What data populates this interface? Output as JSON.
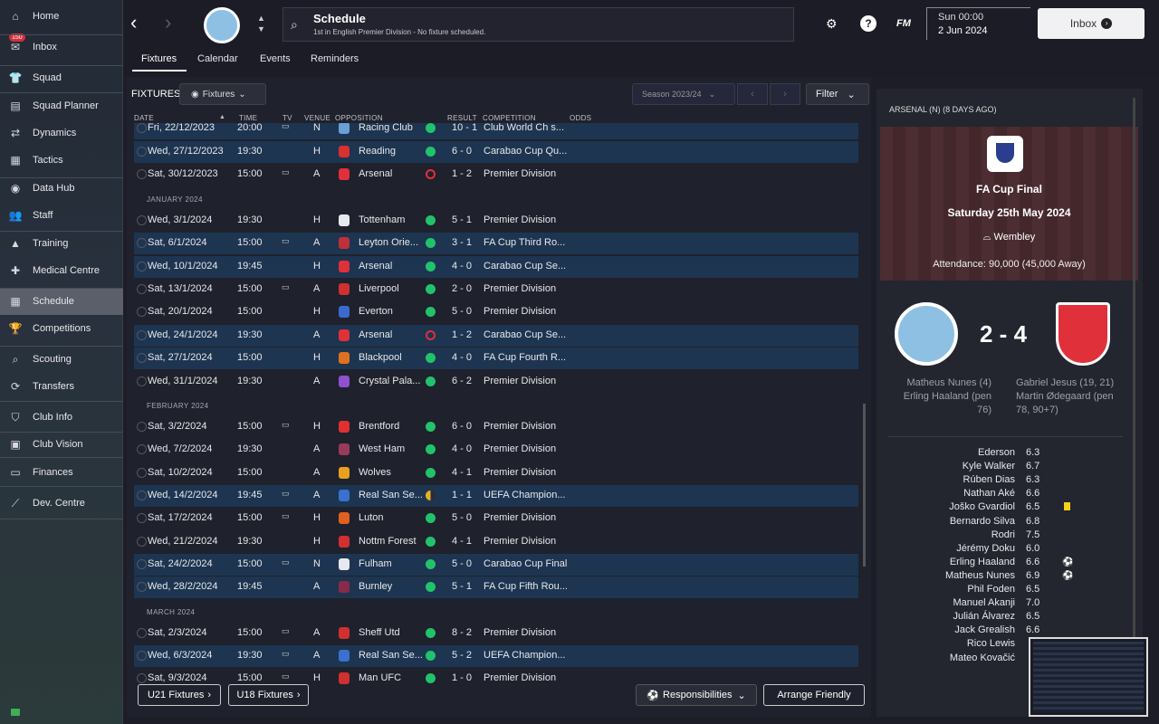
{
  "sidebar": {
    "inbox_badge": "150",
    "items": [
      {
        "label": "Home",
        "icon": "home-icon",
        "glyph": "⌂"
      },
      {
        "label": "Inbox",
        "icon": "inbox-icon",
        "glyph": "✉"
      },
      {
        "label": "Squad",
        "icon": "shirt-icon",
        "glyph": "👕"
      },
      {
        "label": "Squad Planner",
        "icon": "clipboard-icon",
        "glyph": "▤"
      },
      {
        "label": "Dynamics",
        "icon": "dynamics-icon",
        "glyph": "⇄"
      },
      {
        "label": "Tactics",
        "icon": "tactics-icon",
        "glyph": "▦"
      },
      {
        "label": "Data Hub",
        "icon": "data-hub-icon",
        "glyph": "◉"
      },
      {
        "label": "Staff",
        "icon": "staff-icon",
        "glyph": "👥"
      },
      {
        "label": "Training",
        "icon": "training-icon",
        "glyph": "▲"
      },
      {
        "label": "Medical Centre",
        "icon": "medical-icon",
        "glyph": "✚"
      },
      {
        "label": "Schedule",
        "icon": "calendar-icon",
        "glyph": "▦"
      },
      {
        "label": "Competitions",
        "icon": "trophy-icon",
        "glyph": "🏆"
      },
      {
        "label": "Scouting",
        "icon": "scouting-icon",
        "glyph": "⌕"
      },
      {
        "label": "Transfers",
        "icon": "transfers-icon",
        "glyph": "⟳"
      },
      {
        "label": "Club Info",
        "icon": "shield-icon",
        "glyph": "⛉"
      },
      {
        "label": "Club Vision",
        "icon": "briefcase-icon",
        "glyph": "▣"
      },
      {
        "label": "Finances",
        "icon": "finances-icon",
        "glyph": "▭"
      },
      {
        "label": "Dev. Centre",
        "icon": "dev-centre-icon",
        "glyph": "⟋"
      }
    ]
  },
  "header": {
    "title": "Schedule",
    "subtitle": "1st in English Premier Division - No fixture scheduled.",
    "fm": "FM",
    "help": "?",
    "time": "Sun 00:00",
    "date": "2 Jun 2024",
    "inbox_label": "Inbox",
    "tabs": [
      "Fixtures",
      "Calendar",
      "Events",
      "Reminders"
    ]
  },
  "fixtures": {
    "title": "FIXTURES",
    "view_label": "Fixtures",
    "season_label": "Season 2023/24",
    "filter_label": "Filter",
    "columns": [
      "DATE",
      "TIME",
      "TV",
      "VENUE",
      "OPPOSITION",
      "RESULT",
      "COMPETITION",
      "ODDS"
    ],
    "months": [
      "JANUARY 2024",
      "FEBRUARY 2024",
      "MARCH 2024"
    ],
    "rows": [
      {
        "date": "Fri, 22/12/2023",
        "time": "20:00",
        "tv": "▭",
        "venue": "N",
        "opp": "Racing Club",
        "result": "10 - 1",
        "comp": "Club World Ch s...",
        "res_color": "#22c26a",
        "crest": "#6a9fd8",
        "hl": true
      },
      {
        "date": "Wed, 27/12/2023",
        "time": "19:30",
        "tv": "",
        "venue": "H",
        "opp": "Reading",
        "result": "6 - 0",
        "comp": "Carabao Cup Qu...",
        "res_color": "#22c26a",
        "crest": "#d93030",
        "hl": true
      },
      {
        "date": "Sat, 30/12/2023",
        "time": "15:00",
        "tv": "▭",
        "venue": "A",
        "opp": "Arsenal",
        "result": "1 - 2",
        "comp": "Premier Division",
        "res_color": "loss",
        "crest": "#e0303a",
        "hl": false
      },
      {
        "date": "Wed, 3/1/2024",
        "time": "19:30",
        "tv": "",
        "venue": "H",
        "opp": "Tottenham",
        "result": "5 - 1",
        "comp": "Premier Division",
        "res_color": "#22c26a",
        "crest": "#e8e8f0",
        "hl": false
      },
      {
        "date": "Sat, 6/1/2024",
        "time": "15:00",
        "tv": "▭",
        "venue": "A",
        "opp": "Leyton Orie...",
        "result": "3 - 1",
        "comp": "FA Cup Third Ro...",
        "res_color": "#22c26a",
        "crest": "#c0303a",
        "hl": true
      },
      {
        "date": "Wed, 10/1/2024",
        "time": "19:45",
        "tv": "",
        "venue": "H",
        "opp": "Arsenal",
        "result": "4 - 0",
        "comp": "Carabao Cup Se...",
        "res_color": "#22c26a",
        "crest": "#e0303a",
        "hl": true
      },
      {
        "date": "Sat, 13/1/2024",
        "time": "15:00",
        "tv": "▭",
        "venue": "A",
        "opp": "Liverpool",
        "result": "2 - 0",
        "comp": "Premier Division",
        "res_color": "#22c26a",
        "crest": "#d03030",
        "hl": false
      },
      {
        "date": "Sat, 20/1/2024",
        "time": "15:00",
        "tv": "",
        "venue": "H",
        "opp": "Everton",
        "result": "5 - 0",
        "comp": "Premier Division",
        "res_color": "#22c26a",
        "crest": "#3a6ad0",
        "hl": false
      },
      {
        "date": "Wed, 24/1/2024",
        "time": "19:30",
        "tv": "",
        "venue": "A",
        "opp": "Arsenal",
        "result": "1 - 2",
        "comp": "Carabao Cup Se...",
        "res_color": "loss",
        "crest": "#e0303a",
        "hl": true
      },
      {
        "date": "Sat, 27/1/2024",
        "time": "15:00",
        "tv": "",
        "venue": "H",
        "opp": "Blackpool",
        "result": "4 - 0",
        "comp": "FA Cup Fourth R...",
        "res_color": "#22c26a",
        "crest": "#e07020",
        "hl": true
      },
      {
        "date": "Wed, 31/1/2024",
        "time": "19:30",
        "tv": "",
        "venue": "A",
        "opp": "Crystal Pala...",
        "result": "6 - 2",
        "comp": "Premier Division",
        "res_color": "#22c26a",
        "crest": "#9050d0",
        "hl": false
      },
      {
        "date": "Sat, 3/2/2024",
        "time": "15:00",
        "tv": "▭",
        "venue": "H",
        "opp": "Brentford",
        "result": "6 - 0",
        "comp": "Premier Division",
        "res_color": "#22c26a",
        "crest": "#e03030",
        "hl": false
      },
      {
        "date": "Wed, 7/2/2024",
        "time": "19:30",
        "tv": "",
        "venue": "A",
        "opp": "West Ham",
        "result": "4 - 0",
        "comp": "Premier Division",
        "res_color": "#22c26a",
        "crest": "#9a3a5a",
        "hl": false
      },
      {
        "date": "Sat, 10/2/2024",
        "time": "15:00",
        "tv": "",
        "venue": "A",
        "opp": "Wolves",
        "result": "4 - 1",
        "comp": "Premier Division",
        "res_color": "#22c26a",
        "crest": "#e8a020",
        "hl": false
      },
      {
        "date": "Wed, 14/2/2024",
        "time": "19:45",
        "tv": "▭",
        "venue": "A",
        "opp": "Real San Se...",
        "result": "1 - 1",
        "comp": "UEFA Champion...",
        "res_color": "draw",
        "crest": "#3a70d0",
        "hl": true
      },
      {
        "date": "Sat, 17/2/2024",
        "time": "15:00",
        "tv": "▭",
        "venue": "H",
        "opp": "Luton",
        "result": "5 - 0",
        "comp": "Premier Division",
        "res_color": "#22c26a",
        "crest": "#e06020",
        "hl": false
      },
      {
        "date": "Wed, 21/2/2024",
        "time": "19:30",
        "tv": "",
        "venue": "H",
        "opp": "Nottm Forest",
        "result": "4 - 1",
        "comp": "Premier Division",
        "res_color": "#22c26a",
        "crest": "#d03030",
        "hl": false
      },
      {
        "date": "Sat, 24/2/2024",
        "time": "15:00",
        "tv": "▭",
        "venue": "N",
        "opp": "Fulham",
        "result": "5 - 0",
        "comp": "Carabao Cup Final",
        "res_color": "#22c26a",
        "crest": "#e8e8f0",
        "hl": true
      },
      {
        "date": "Wed, 28/2/2024",
        "time": "19:45",
        "tv": "",
        "venue": "A",
        "opp": "Burnley",
        "result": "5 - 1",
        "comp": "FA Cup Fifth Rou...",
        "res_color": "#22c26a",
        "crest": "#8a2a4a",
        "hl": true
      },
      {
        "date": "Sat, 2/3/2024",
        "time": "15:00",
        "tv": "▭",
        "venue": "A",
        "opp": "Sheff Utd",
        "result": "8 - 2",
        "comp": "Premier Division",
        "res_color": "#22c26a",
        "crest": "#d03030",
        "hl": false
      },
      {
        "date": "Wed, 6/3/2024",
        "time": "19:30",
        "tv": "▭",
        "venue": "A",
        "opp": "Real San Se...",
        "result": "5 - 2",
        "comp": "UEFA Champion...",
        "res_color": "#22c26a",
        "crest": "#3a70d0",
        "hl": true
      },
      {
        "date": "Sat, 9/3/2024",
        "time": "15:00",
        "tv": "▭",
        "venue": "H",
        "opp": "Man UFC",
        "result": "1 - 0",
        "comp": "Premier Division",
        "res_color": "#22c26a",
        "crest": "#d03030",
        "hl": false
      }
    ],
    "u21_label": "U21 Fixtures",
    "u18_label": "U18 Fixtures",
    "responsibilities_label": "Responsibilities",
    "arrange_label": "Arrange Friendly"
  },
  "match": {
    "header": "ARSENAL (N) (8 DAYS AGO)",
    "competition": "FA Cup Final",
    "date": "Saturday 25th May 2024",
    "venue": "Wembley",
    "attendance": "Attendance: 90,000 (45,000 Away)",
    "score": "2 - 4",
    "home_scorers": [
      "Matheus Nunes (4)",
      "Erling Haaland (pen 76)"
    ],
    "away_scorers": [
      "Gabriel Jesus (19, 21)",
      "Martin Ødegaard (pen",
      "78, 90+7)"
    ],
    "players": [
      {
        "name": "Ederson",
        "rating": "6.3"
      },
      {
        "name": "Kyle Walker",
        "rating": "6.7"
      },
      {
        "name": "Rúben Dias",
        "rating": "6.3"
      },
      {
        "name": "Nathan Aké",
        "rating": "6.6"
      },
      {
        "name": "Joško Gvardiol",
        "rating": "6.5",
        "icon": "yellow-card"
      },
      {
        "name": "Bernardo Silva",
        "rating": "6.8"
      },
      {
        "name": "Rodri",
        "rating": "7.5"
      },
      {
        "name": "Jérémy Doku",
        "rating": "6.0"
      },
      {
        "name": "Erling Haaland",
        "rating": "6.6",
        "icon": "ball"
      },
      {
        "name": "Matheus Nunes",
        "rating": "6.9",
        "icon": "ball"
      },
      {
        "name": "Phil Foden",
        "rating": "6.5"
      },
      {
        "name": "Manuel Akanji",
        "rating": "7.0"
      },
      {
        "name": "Julián Álvarez",
        "rating": "6.5"
      },
      {
        "name": "Jack Grealish",
        "rating": "6.6"
      },
      {
        "name": "Rico Lewis",
        "rating": ""
      },
      {
        "name": "Mateo Kovačić",
        "rating": ""
      }
    ]
  }
}
